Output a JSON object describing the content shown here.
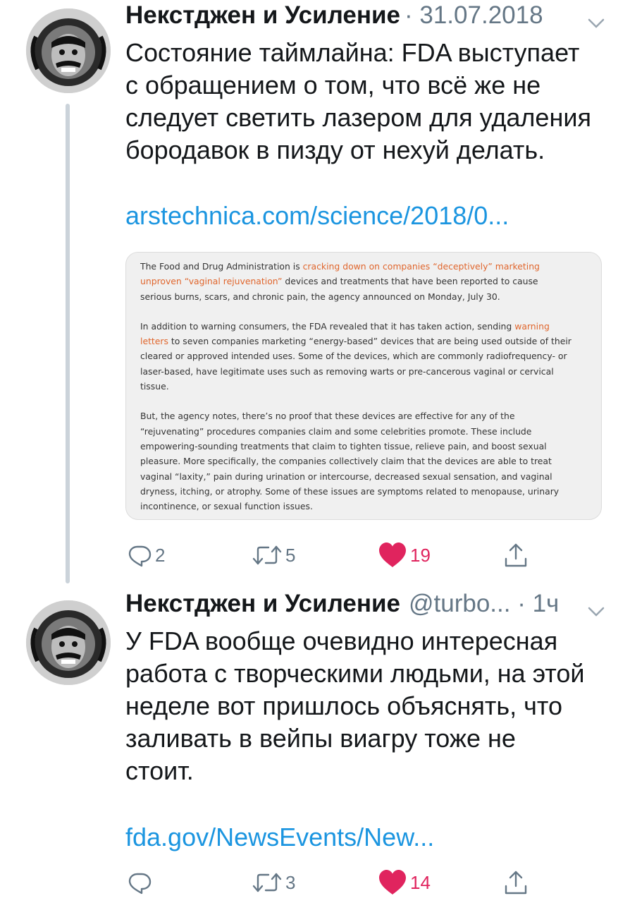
{
  "tweets": [
    {
      "author_name": "Некстджен и Усиление",
      "meta": "· 31.07.2018",
      "text_lines": [
        "Состояние таймлайна: FDA выступает",
        "с обращением о том, что всё же не",
        "следует светить лазером для удаления",
        "бородавок в пизду от нехуй делать."
      ],
      "link": "arstechnica.com/science/2018/0...",
      "card": {
        "paragraphs": [
          {
            "lines": [
              [
                "The Food and Drug Administration is ",
                "cracking down on companies “deceptively” marketing"
              ],
              [
                "unproven “vaginal rejuvenation”",
                " devices and treatments that have been reported to cause"
              ],
              [
                "serious burns, scars, and chronic pain, the agency announced on Monday, July 30."
              ]
            ]
          },
          {
            "lines": [
              [
                "In addition to warning consumers, the FDA revealed that it has taken action, sending ",
                "warning"
              ],
              [
                "letters",
                " to seven companies marketing “energy-based” devices that are being used outside of their"
              ],
              [
                "cleared or approved intended uses. Some of the devices, which are commonly radiofrequency- or"
              ],
              [
                "laser-based, have legitimate uses such as removing warts or pre-cancerous vaginal or cervical"
              ],
              [
                "tissue."
              ]
            ]
          },
          {
            "lines": [
              [
                "But, the agency notes, there’s no proof that these devices are effective for any of the"
              ],
              [
                "“rejuvenating” procedures companies claim and some celebrities promote. These include"
              ],
              [
                "empowering-sounding treatments that claim to tighten tissue, relieve pain, and boost sexual"
              ],
              [
                "pleasure. More specifically, the companies collectively claim that the devices are able to treat"
              ],
              [
                "vaginal “laxity,” pain during urination or intercourse, decreased sexual sensation, and vaginal"
              ],
              [
                "dryness, itching, or atrophy. Some of these issues are symptoms related to menopause, urinary"
              ],
              [
                "incontinence, or sexual function issues."
              ]
            ]
          }
        ]
      },
      "actions": {
        "reply_count": "2",
        "retweet_count": "5",
        "like_count": "19",
        "liked": true
      }
    },
    {
      "author_name": "Некстджен и Усиление",
      "meta": "@turbo... · 1ч",
      "text_lines": [
        "У FDA вообще очевидно интересная",
        "работа с творческими людьми, на этой",
        "неделе вот пришлось объяснять, что",
        "заливать в вейпы виагру тоже не",
        "стоит."
      ],
      "link": "fda.gov/NewsEvents/New...",
      "actions": {
        "reply_count": "",
        "retweet_count": "3",
        "like_count": "14",
        "liked": true
      }
    }
  ],
  "colors": {
    "text": "#14171a",
    "meta": "#657786",
    "link": "#1b95e0",
    "like": "#e0245e",
    "card_highlight": "#e0662d",
    "thread_line": "#cbd3da"
  },
  "icons": [
    "avatar-image",
    "chevron-down-icon",
    "reply-icon",
    "retweet-icon",
    "heart-icon",
    "share-icon"
  ]
}
